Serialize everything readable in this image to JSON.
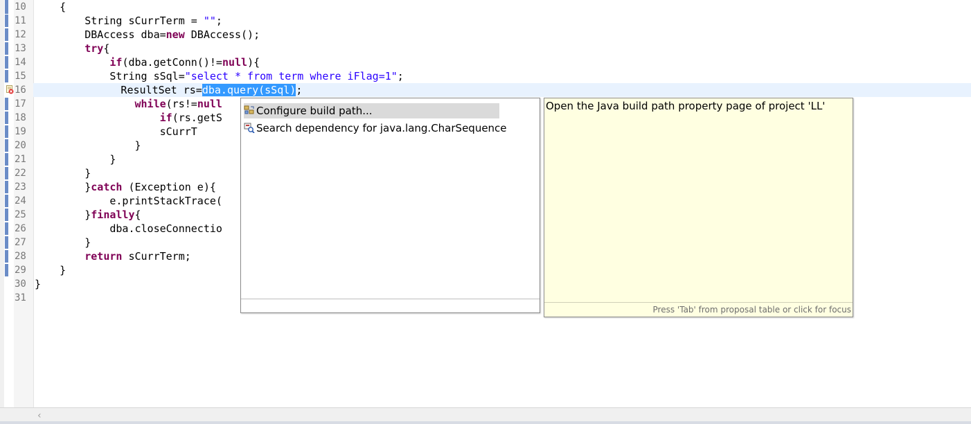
{
  "editor": {
    "line_numbers": [
      "10",
      "11",
      "12",
      "13",
      "14",
      "15",
      "16",
      "17",
      "18",
      "19",
      "20",
      "21",
      "22",
      "23",
      "24",
      "25",
      "26",
      "27",
      "28",
      "29",
      "30",
      "31"
    ],
    "lines": {
      "l10": {
        "a": "    {"
      },
      "l11": {
        "a": "        String sCurrTerm = ",
        "s": "\"\"",
        "b": ";"
      },
      "l12": {
        "a": "        DBAccess dba=",
        "k": "new",
        "b": " DBAccess();"
      },
      "l13": {
        "k": "try",
        "b": "{"
      },
      "l14": {
        "k": "if",
        "a": "(dba.getConn()!=",
        "k2": "null",
        "b": "){"
      },
      "l15": {
        "a": "            String sSql=",
        "s": "\"select * from term where iFlag=1\"",
        "b": ";"
      },
      "l16": {
        "a": "            ResultSet rs=",
        "sel": "dba.query(sSql)",
        "b": ";"
      },
      "l17": {
        "k": "while",
        "a": "(rs!=",
        "k2": "null"
      },
      "l18": {
        "k": "if",
        "a": "(rs.getS"
      },
      "l19": {
        "a": "                    sCurrT"
      },
      "l20": {
        "a": "                }"
      },
      "l21": {
        "a": "            }"
      },
      "l22": {
        "a": "        }"
      },
      "l23": {
        "a": "    }",
        "k": "catch",
        "b": " (Exception e){"
      },
      "l24": {
        "a": "            e.printStackTrace("
      },
      "l25": {
        "a": "    }",
        "k": "finally",
        "b": "{"
      },
      "l26": {
        "a": "            dba.closeConnectio"
      },
      "l27": {
        "a": "        }"
      },
      "l28": {
        "k": "return",
        "b": " sCurrTerm;"
      },
      "l29": {
        "a": "    }"
      },
      "l30": {
        "a": "}"
      }
    }
  },
  "quick_fix": {
    "proposals": [
      {
        "label": "Configure build path...",
        "icon": "build-path-icon",
        "selected": true
      },
      {
        "label": "Search dependency for java.lang.CharSequence",
        "icon": "search-dependency-icon",
        "selected": false
      }
    ]
  },
  "info_popup": {
    "text": "Open the Java build path property page of project 'LL'",
    "hint": "Press 'Tab' from proposal table or click for focus"
  },
  "colors": {
    "keyword": "#7f0055",
    "string": "#2a00ff",
    "selection": "#3399ff",
    "current_line": "#e8f2fe",
    "info_background": "#ffffe1"
  }
}
